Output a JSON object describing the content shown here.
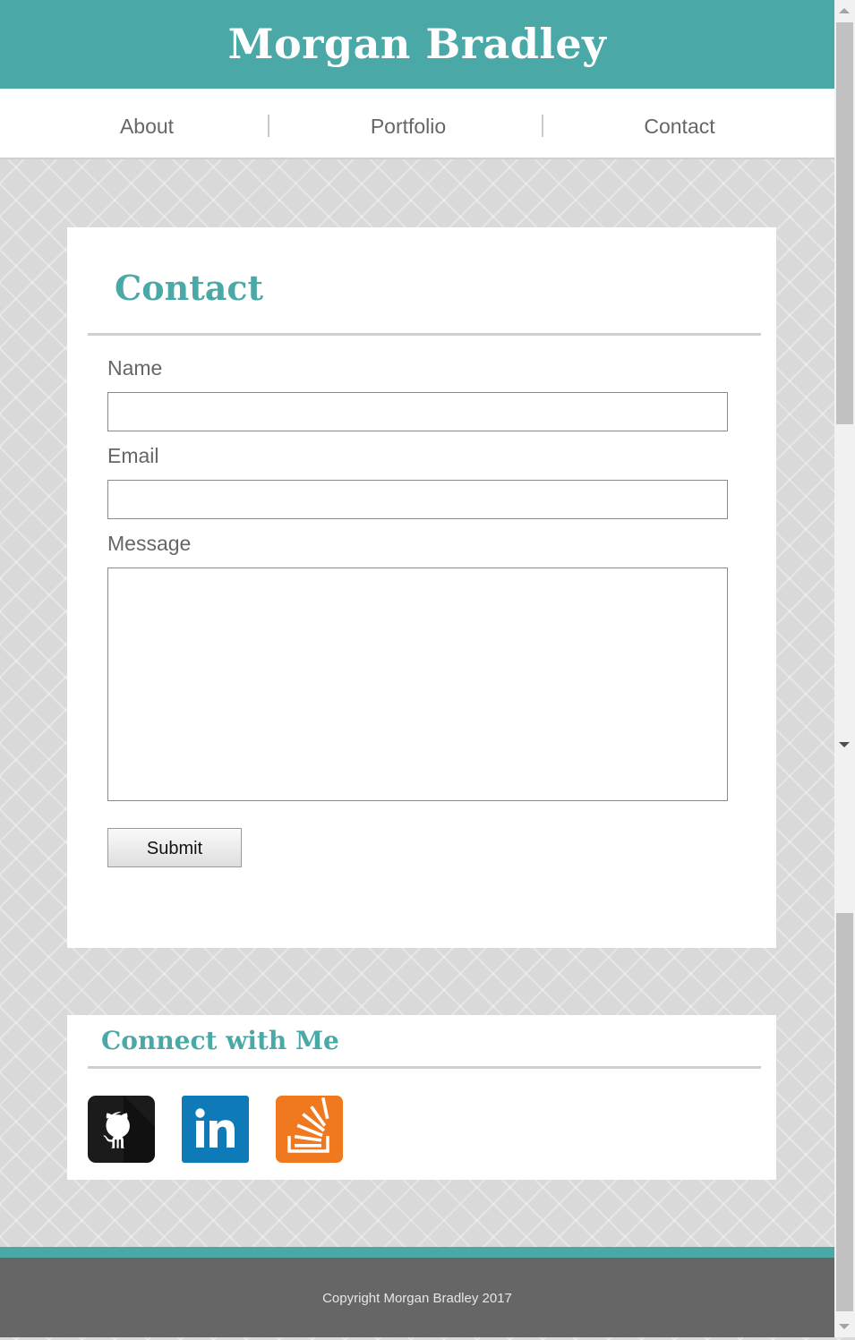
{
  "site_title": "Morgan Bradley",
  "nav": {
    "items": [
      {
        "label": "About"
      },
      {
        "label": "Portfolio"
      },
      {
        "label": "Contact"
      }
    ]
  },
  "contact": {
    "title": "Contact",
    "name_label": "Name",
    "email_label": "Email",
    "message_label": "Message",
    "name_value": "",
    "email_value": "",
    "message_value": "",
    "submit_label": "Submit"
  },
  "connect": {
    "title": "Connect with Me",
    "links": [
      {
        "icon": "github-icon",
        "color": "#1b1b1b"
      },
      {
        "icon": "linkedin-icon",
        "color": "#0e7ab8"
      },
      {
        "icon": "stackoverflow-icon",
        "color": "#f0791f"
      }
    ]
  },
  "footer": {
    "copyright": "Copyright Morgan Bradley 2017"
  },
  "colors": {
    "accent": "#4aa9a6",
    "footer": "#666666"
  }
}
